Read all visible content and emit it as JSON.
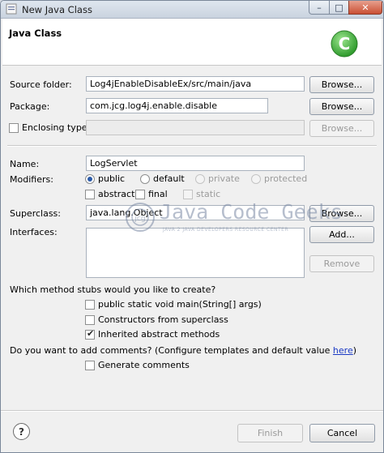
{
  "window": {
    "title": "New Java Class",
    "minimize_glyph": "–",
    "maximize_glyph": "□",
    "close_glyph": "✕"
  },
  "banner": {
    "title": "Java Class",
    "icon": "class-wizard-icon",
    "icon_letter": "C",
    "icon_color": "#3cae3a"
  },
  "form": {
    "source_folder": {
      "label": "Source folder:",
      "value": "Log4jEnableDisableEx/src/main/java",
      "button": "Browse..."
    },
    "package": {
      "label": "Package:",
      "value": "com.jcg.log4j.enable.disable",
      "button": "Browse..."
    },
    "enclosing_type": {
      "label": "Enclosing type:",
      "value": "",
      "button": "Browse...",
      "checked": false
    },
    "name": {
      "label": "Name:",
      "value": "LogServlet"
    },
    "modifiers": {
      "label": "Modifiers:",
      "access": [
        "public",
        "default",
        "private",
        "protected"
      ],
      "selected": "public",
      "flags": [
        "abstract",
        "final",
        "static"
      ]
    },
    "superclass": {
      "label": "Superclass:",
      "value": "java.lang.Object",
      "button": "Browse..."
    },
    "interfaces": {
      "label": "Interfaces:",
      "add_button": "Add...",
      "remove_button": "Remove"
    },
    "stubs": {
      "question": "Which method stubs would you like to create?",
      "options": [
        {
          "label": "public static void main(String[] args)",
          "checked": false
        },
        {
          "label": "Constructors from superclass",
          "checked": false
        },
        {
          "label": "Inherited abstract methods",
          "checked": true
        }
      ]
    },
    "comments": {
      "question": "Do you want to add comments? (Configure templates and default value ",
      "link": "here",
      "question_end": ")",
      "option": "Generate comments",
      "checked": false
    }
  },
  "watermark": {
    "text": "Java Code Geeks",
    "subtitle": "JAVA 2 JAVA DEVELOPERS RESOURCE CENTER",
    "logo_text": "jcg"
  },
  "footer": {
    "help_glyph": "?",
    "finish": "Finish",
    "cancel": "Cancel"
  },
  "colors": {
    "link": "#1a39c4",
    "radio_selected": "#2a5aa8",
    "close_button": "#c94f33"
  }
}
